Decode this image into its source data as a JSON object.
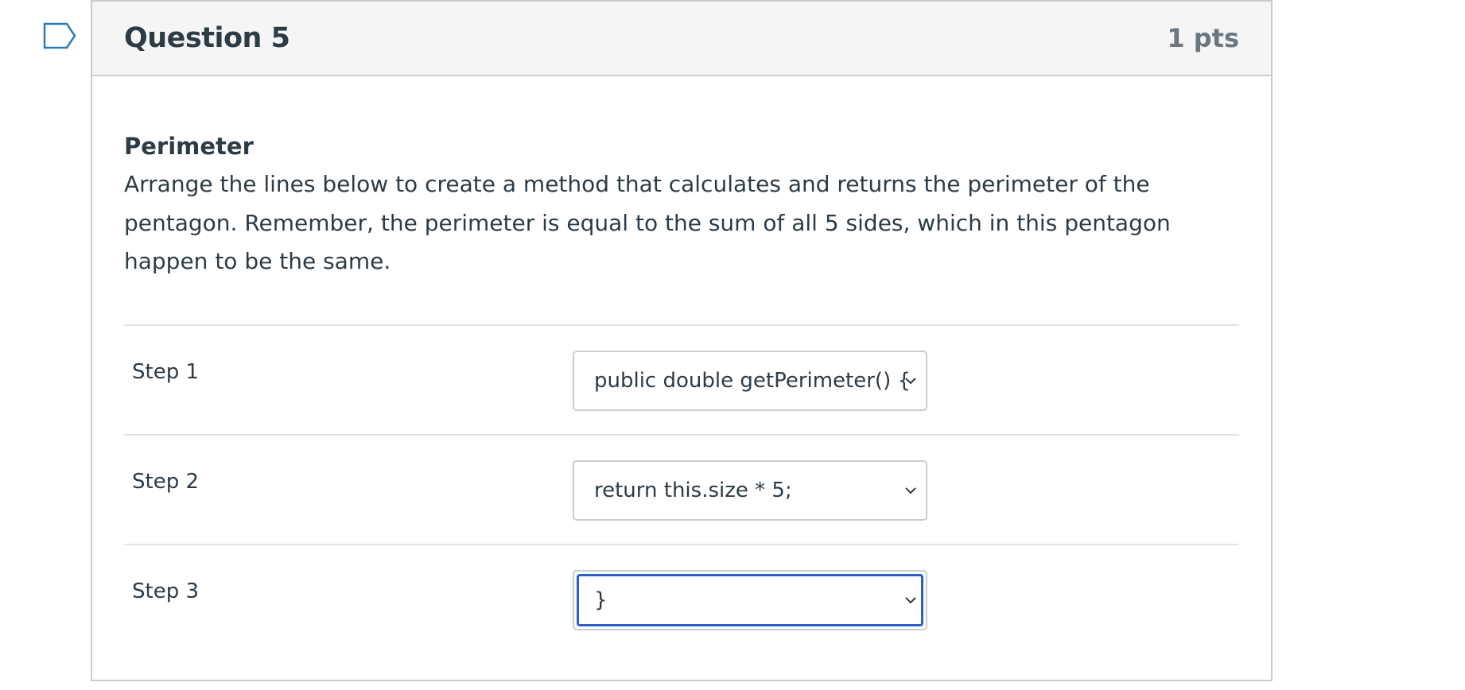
{
  "question": {
    "title": "Question 5",
    "points": "1 pts",
    "subtitle": "Perimeter",
    "description": "Arrange the lines below to create a method that calculates and returns the perimeter of the pentagon. Remember, the perimeter is equal to the sum of all 5 sides, which in this pentagon happen to be the same."
  },
  "steps": [
    {
      "label": "Step 1",
      "selected": "public double getPerimeter() {"
    },
    {
      "label": "Step 2",
      "selected": "return this.size * 5;"
    },
    {
      "label": "Step 3",
      "selected": "}"
    }
  ],
  "icons": {
    "flag": "bookmark-flag-icon",
    "dropdown": "chevron-down-icon"
  },
  "colors": {
    "focus_ring": "#2b5fc1",
    "header_bg": "#f5f5f5",
    "border": "#c7cdd1",
    "flag": "#2b7abc"
  }
}
